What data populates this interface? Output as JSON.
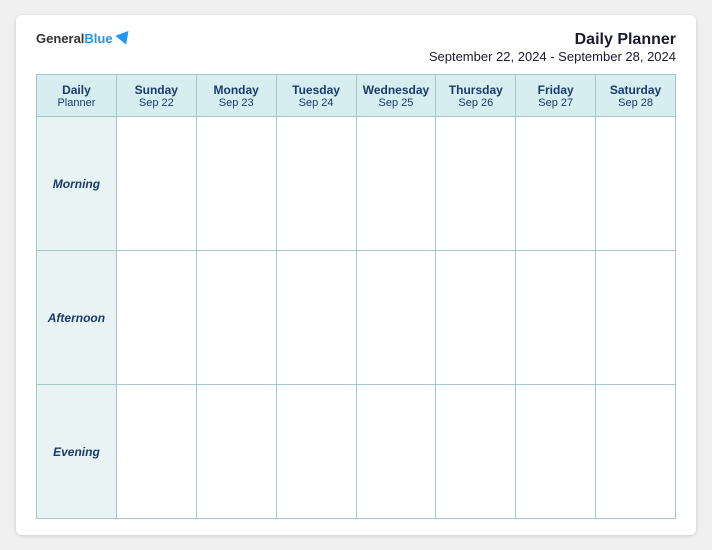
{
  "logo": {
    "general": "General",
    "blue": "Blue"
  },
  "header": {
    "title": "Daily Planner",
    "subtitle": "September 22, 2024 - September 28, 2024"
  },
  "columns": [
    {
      "label": "Daily\nPlanner",
      "day": "",
      "date": ""
    },
    {
      "label": "Sunday",
      "day": "Sunday",
      "date": "Sep 22"
    },
    {
      "label": "Monday",
      "day": "Monday",
      "date": "Sep 23"
    },
    {
      "label": "Tuesday",
      "day": "Tuesday",
      "date": "Sep 24"
    },
    {
      "label": "Wednesday",
      "day": "Wednesday",
      "date": "Sep 25"
    },
    {
      "label": "Thursday",
      "day": "Thursday",
      "date": "Sep 26"
    },
    {
      "label": "Friday",
      "day": "Friday",
      "date": "Sep 27"
    },
    {
      "label": "Saturday",
      "day": "Saturday",
      "date": "Sep 28"
    }
  ],
  "rows": [
    {
      "label": "Morning"
    },
    {
      "label": "Afternoon"
    },
    {
      "label": "Evening"
    }
  ]
}
